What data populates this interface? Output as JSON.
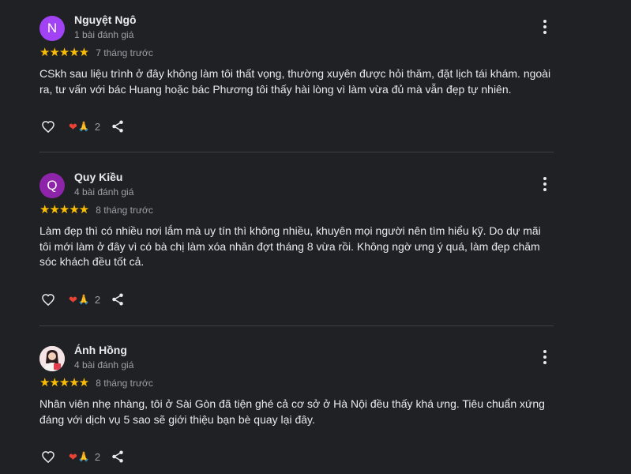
{
  "colors": {
    "background": "#202124",
    "star": "#fbbc04",
    "heart": "#ea4335",
    "text": "#e8eaed",
    "muted": "#9aa0a6"
  },
  "icons": {
    "more": "more-vertical-icon",
    "like": "thumb-up-outline-icon",
    "share": "share-icon",
    "reaction_heart": "heart-icon",
    "reaction_pray": "folded-hands-icon"
  },
  "reviews": [
    {
      "author": "Nguyệt Ngô",
      "avatar_letter": "N",
      "avatar_color": "#a142f4",
      "review_count": "1 bài đánh giá",
      "stars": "★★★★★",
      "rating": 5,
      "time": "7 tháng trước",
      "text": "CSkh sau liệu trình ở đây không làm tôi thất vọng, thường xuyên được hỏi thăm, đặt lịch tái khám. ngoài ra, tư vấn với bác Huang hoặc bác Phương tôi thấy hài lòng vì làm vừa đủ mà vẫn đẹp tự nhiên.",
      "reaction_emoji": [
        "❤",
        "🙏"
      ],
      "reaction_count": "2"
    },
    {
      "author": "Quy Kiều",
      "avatar_letter": "Q",
      "avatar_color": "#8e24aa",
      "review_count": "4 bài đánh giá",
      "stars": "★★★★★",
      "rating": 5,
      "time": "8 tháng trước",
      "text": "Làm đẹp thì có nhiều nơi lắm mà uy tín thì không nhiều, khuyên mọi người nên tìm hiểu kỹ. Do dự mãi tôi mới làm ở đây vì có bà chị làm xóa nhăn đợt tháng 8 vừa rồi. Không ngờ ưng ý quá, làm đẹp chăm sóc khách đều tốt cả.",
      "reaction_emoji": [
        "❤",
        "🙏"
      ],
      "reaction_count": "2"
    },
    {
      "author": "Ánh Hồng",
      "avatar_letter": "",
      "avatar_color": "#f3e0e3",
      "review_count": "4 bài đánh giá",
      "stars": "★★★★★",
      "rating": 5,
      "time": "8 tháng trước",
      "text": "Nhân viên nhẹ nhàng, tôi ở Sài Gòn đã tiện ghé cả cơ sở ở Hà Nội đều thấy khá ưng. Tiêu chuẩn xứng đáng với dịch vụ 5 sao sẽ giới thiệu bạn bè quay lại đây.",
      "reaction_emoji": [
        "❤",
        "🙏"
      ],
      "reaction_count": "2"
    }
  ]
}
